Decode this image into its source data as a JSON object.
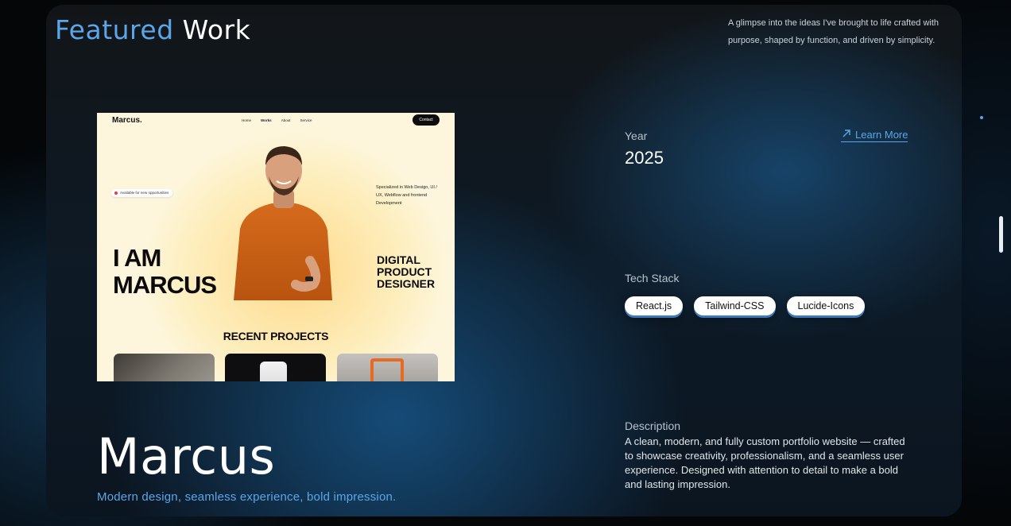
{
  "header": {
    "title_accent": "Featured",
    "title_rest": "Work",
    "intro": "A glimpse into the ideas I've brought to life crafted with purpose, shaped by function, and driven by simplicity."
  },
  "preview": {
    "logo": "Marcus.",
    "nav": [
      "Home",
      "Works",
      "About",
      "Service"
    ],
    "contact": "Contact",
    "badge": "Available for new opportunities",
    "specialty": "Specialized in Web Design, UI / UX, Webflow and frontend Development",
    "headline_line1": "I AM",
    "headline_line2": "MARCUS",
    "role_line1": "DIGITAL",
    "role_line2": "PRODUCT",
    "role_line3": "DESIGNER",
    "recent": "RECENT PROJECTS"
  },
  "project": {
    "name": "Marcus",
    "tagline": "Modern design, seamless experience, bold impression.",
    "year_label": "Year",
    "year": "2025",
    "learn_more": "Learn More",
    "tech_label": "Tech Stack",
    "tech": [
      "React.js",
      "Tailwind-CSS",
      "Lucide-Icons"
    ],
    "description_label": "Description",
    "description": "A clean, modern, and fully custom portfolio website — crafted to showcase creativity, professionalism, and a seamless user experience. Designed with attention to detail to make a bold and lasting impression."
  },
  "colors": {
    "accent": "#5aa6e8",
    "card_background": "#0d1a26",
    "chip_shadow": "#3d78b8"
  }
}
